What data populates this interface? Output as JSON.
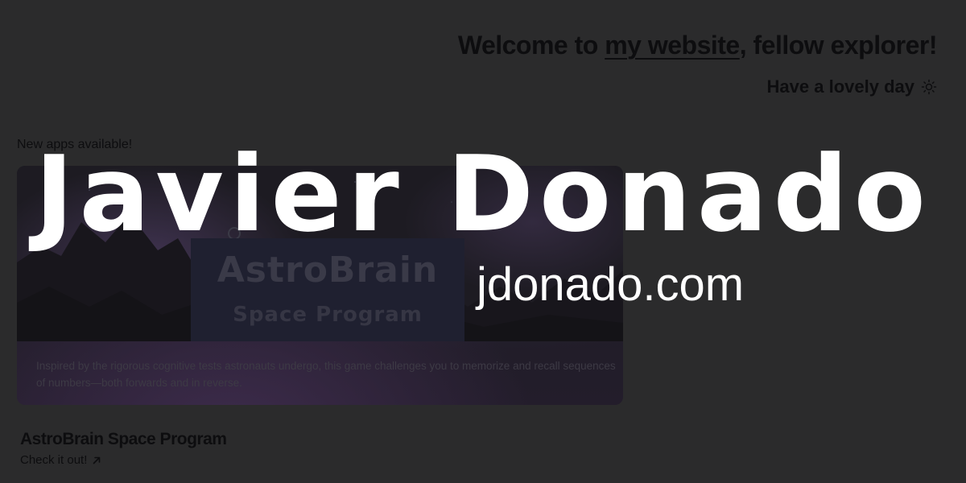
{
  "header": {
    "welcome_before": "Welcome to ",
    "welcome_link": "my website",
    "welcome_after": ", fellow explorer!",
    "greeting": "Have a lovely day",
    "greeting_icon": "sun-icon"
  },
  "apps": {
    "section_label": "New apps available!",
    "featured": {
      "logo_title": "AstroBrain",
      "logo_subtitle": "Space Program",
      "description": "Inspired by the rigorous cognitive tests astronauts undergo, this game challenges you to memorize and recall sequences of numbers—both forwards and in reverse.",
      "name": "AstroBrain Space Program",
      "link_label": "Check it out!",
      "link_icon": "arrow-up-right-icon"
    }
  },
  "overlay": {
    "name": "Javier Donado",
    "url": "jdonado.com"
  },
  "colors": {
    "background": "#2b2b2c",
    "dim_text": "#0d0d0f",
    "overlay_text": "#ffffff"
  }
}
